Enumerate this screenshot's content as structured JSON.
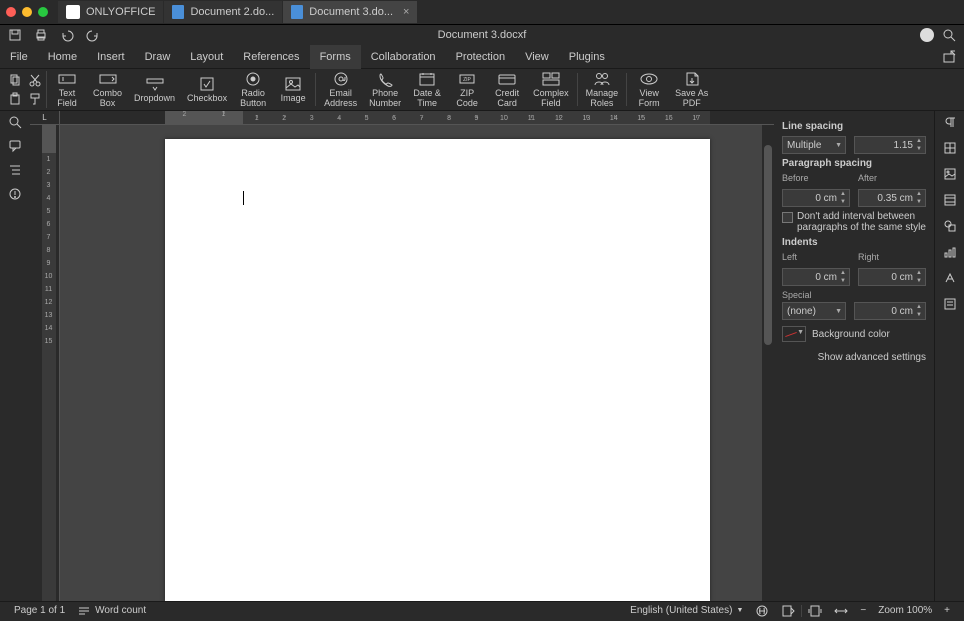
{
  "titlebar": {
    "app_tab": "ONLYOFFICE",
    "tabs": [
      {
        "label": "Document 2.do..."
      },
      {
        "label": "Document 3.do..."
      }
    ],
    "active_tab_index": 1
  },
  "document_title": "Document 3.docxf",
  "menu": {
    "items": [
      "File",
      "Home",
      "Insert",
      "Draw",
      "Layout",
      "References",
      "Forms",
      "Collaboration",
      "Protection",
      "View",
      "Plugins"
    ],
    "active": "Forms"
  },
  "ribbon": {
    "buttons": [
      {
        "label": "Text\nField",
        "dd": true
      },
      {
        "label": "Combo\nBox"
      },
      {
        "label": "Dropdown"
      },
      {
        "label": "Checkbox"
      },
      {
        "label": "Radio\nButton"
      },
      {
        "label": "Image"
      },
      {
        "sep": true
      },
      {
        "label": "Email\nAddress"
      },
      {
        "label": "Phone\nNumber"
      },
      {
        "label": "Date &\nTime"
      },
      {
        "label": "ZIP\nCode"
      },
      {
        "label": "Credit\nCard"
      },
      {
        "label": "Complex\nField"
      },
      {
        "sep": true
      },
      {
        "label": "Manage\nRoles"
      },
      {
        "sep": true
      },
      {
        "label": "View\nForm",
        "dd": true
      },
      {
        "label": "Save As\nPDF"
      }
    ]
  },
  "ruler": {
    "unit": "cm",
    "h_ticks_neg": [
      2,
      1
    ],
    "h_ticks": [
      1,
      2,
      3,
      4,
      5,
      6,
      7,
      8,
      9,
      10,
      11,
      12,
      13,
      14,
      15,
      16,
      17
    ],
    "v_ticks": [
      1,
      2,
      3,
      4,
      5,
      6,
      7,
      8,
      9,
      10,
      11,
      12,
      13,
      14,
      15
    ]
  },
  "right_panel": {
    "line_spacing_hdr": "Line spacing",
    "line_spacing_mode": "Multiple",
    "line_spacing_value": "1.15",
    "paragraph_spacing_hdr": "Paragraph spacing",
    "before_label": "Before",
    "after_label": "After",
    "before_value": "0 cm",
    "after_value": "0.35 cm",
    "no_interval_label": "Don't add interval between paragraphs of the same style",
    "indents_hdr": "Indents",
    "left_label": "Left",
    "right_label": "Right",
    "left_value": "0 cm",
    "right_value": "0 cm",
    "special_label": "Special",
    "special_value": "(none)",
    "special_by": "0 cm",
    "bg_color_label": "Background color",
    "advanced_link": "Show advanced settings"
  },
  "status": {
    "page": "Page 1 of 1",
    "word_count": "Word count",
    "language": "English (United States)",
    "zoom": "Zoom 100%"
  }
}
